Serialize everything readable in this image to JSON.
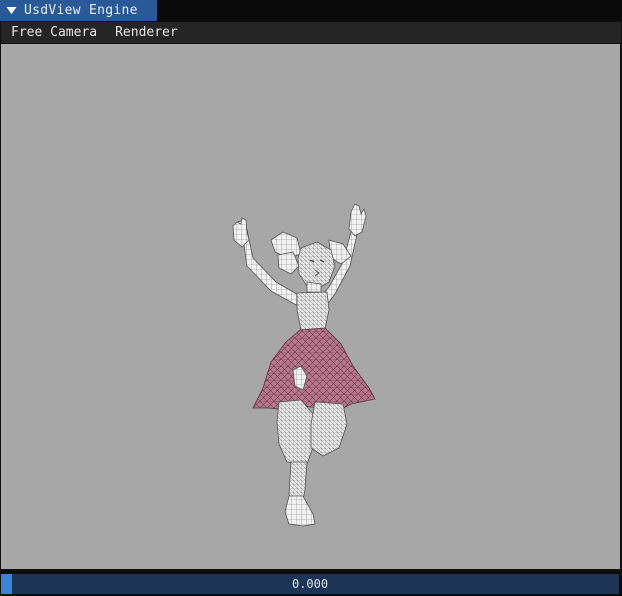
{
  "window": {
    "title": "UsdView Engine"
  },
  "menubar": {
    "items": [
      "Free Camera",
      "Renderer"
    ]
  },
  "viewport": {
    "background": "#a7a7a7",
    "model_colors": {
      "mesh": "#f2f2f2",
      "wire": "#6b6b6b",
      "skirt": "#b9788e"
    }
  },
  "timeline": {
    "current_time": "0.000",
    "progress": 0,
    "track_color": "#1c3456",
    "handle_color": "#3a82d4"
  }
}
